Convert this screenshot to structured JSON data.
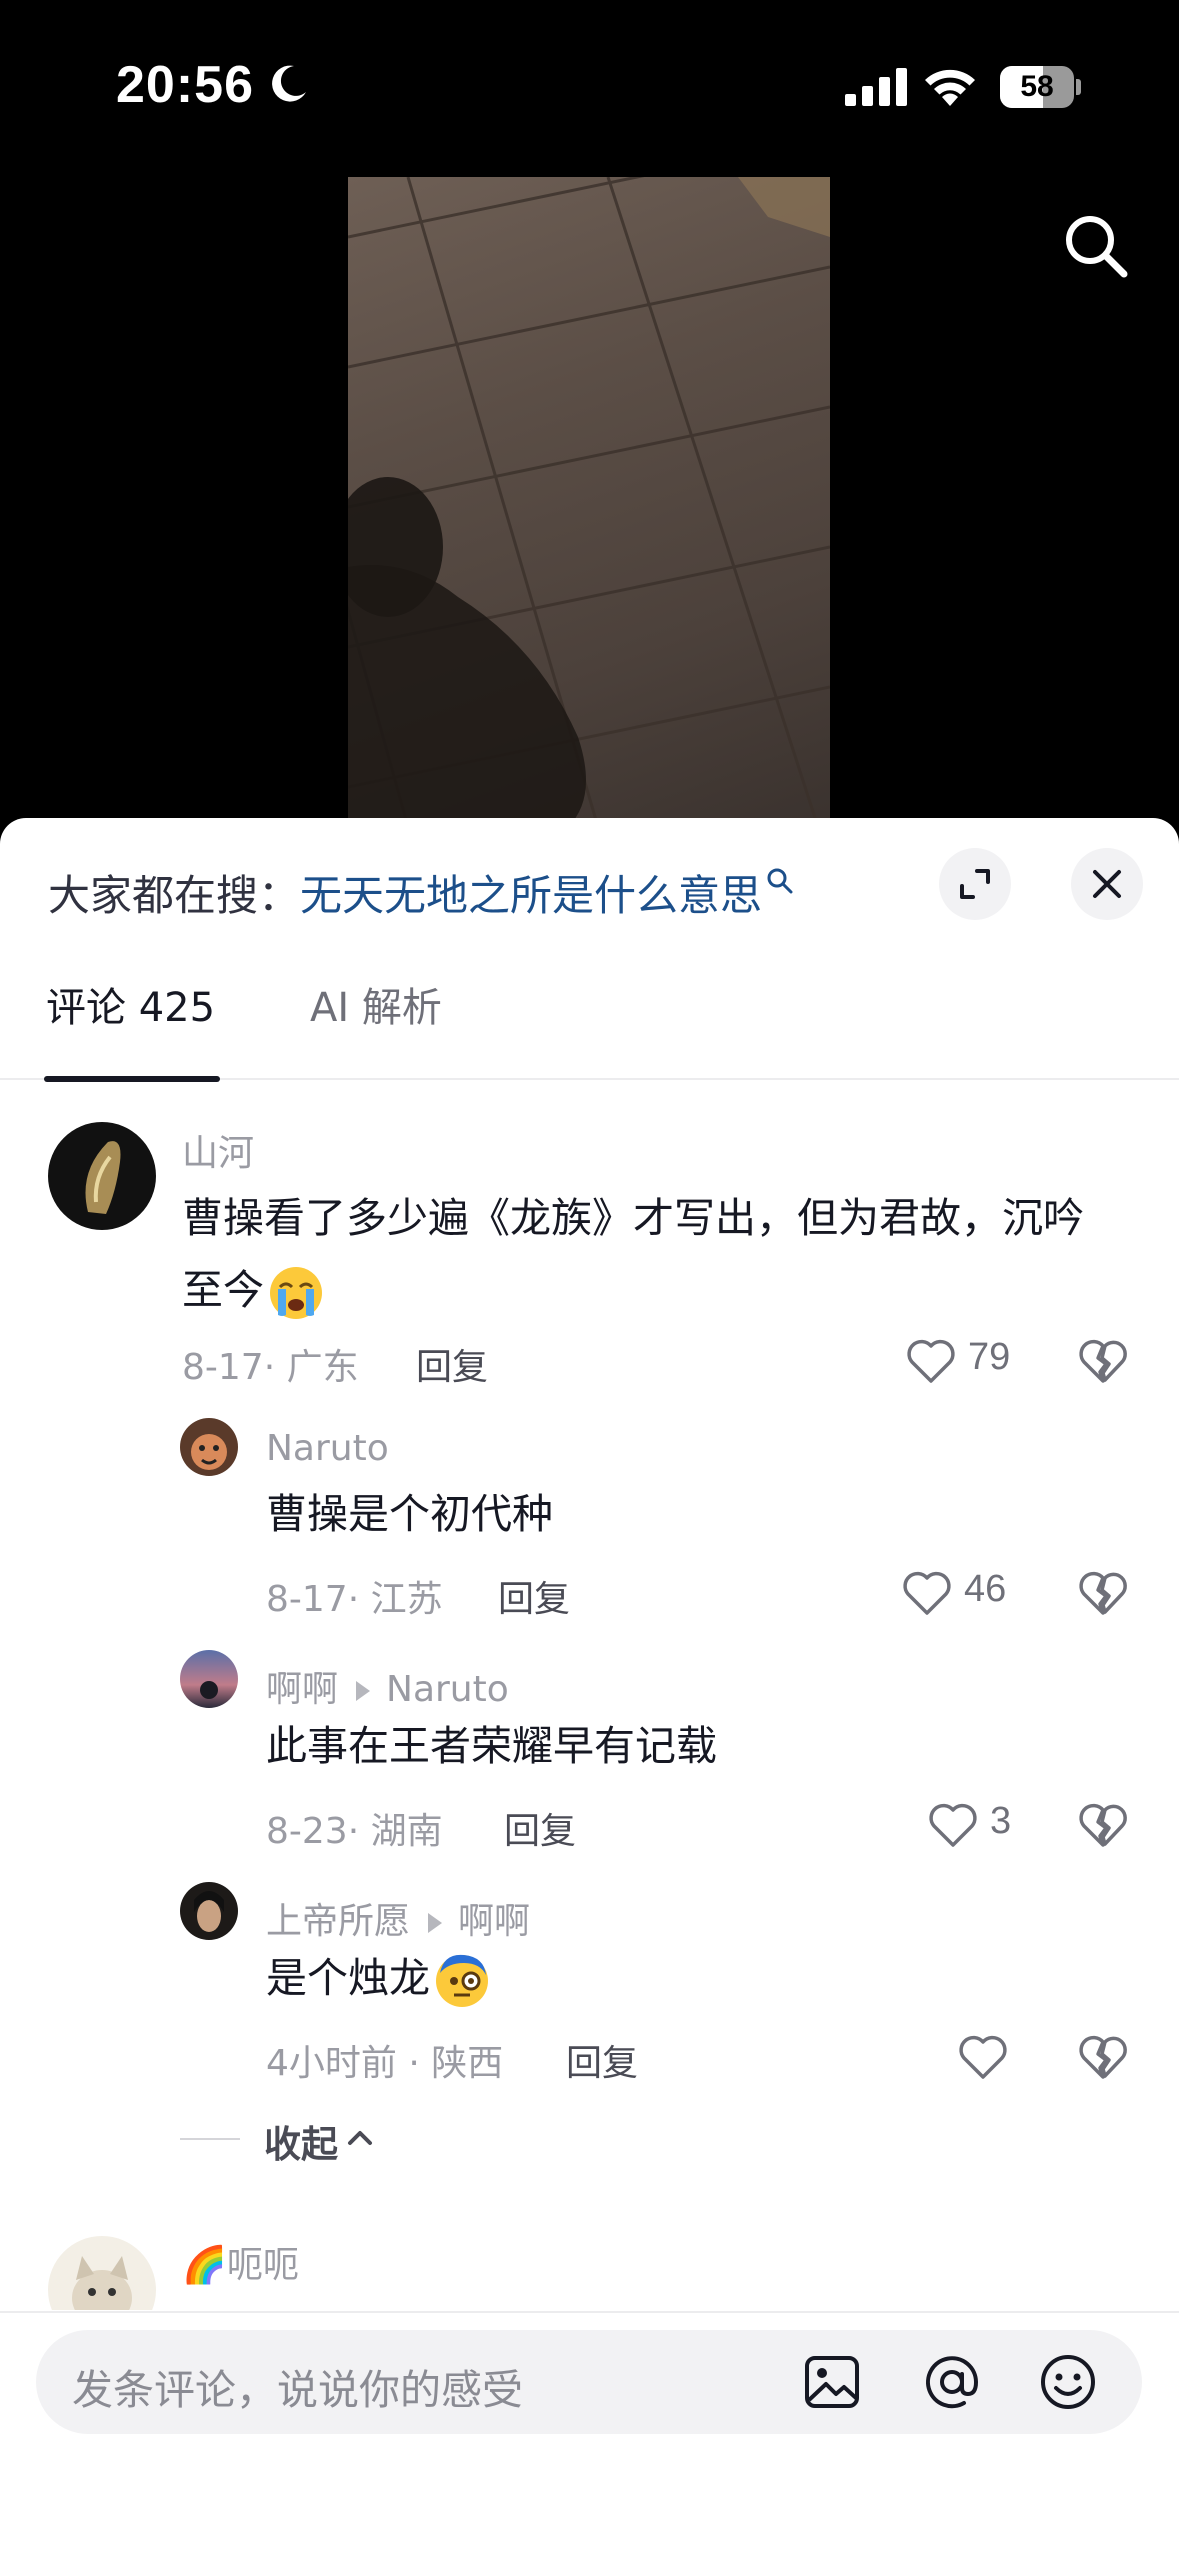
{
  "status_bar": {
    "time": "20:56",
    "battery_percent": "58",
    "battery_level": 0.58
  },
  "video": {
    "description_icons": [
      "search-icon"
    ]
  },
  "hot_search": {
    "prefix": "大家都在搜：",
    "query": "无天无地之所是什么意思"
  },
  "tabs": [
    {
      "label": "评论 425",
      "active": true
    },
    {
      "label": "AI 解析",
      "active": false
    }
  ],
  "comments": [
    {
      "author": "山河",
      "text": "曹操看了多少遍《龙族》才写出，但为君故，沉吟至今",
      "emoji": "loudly-crying-face",
      "date": "8-17",
      "location": "广东",
      "reply_label": "回复",
      "likes": "79"
    },
    {
      "author": "Naruto",
      "text": "曹操是个初代种",
      "date": "8-17",
      "location": "江苏",
      "reply_label": "回复",
      "likes": "46"
    },
    {
      "author": "啊啊",
      "reply_to": "Naruto",
      "text": "此事在王者荣耀早有记载",
      "date": "8-23",
      "location": "湖南",
      "reply_label": "回复",
      "likes": "3"
    },
    {
      "author": "上帝所愿",
      "reply_to": "啊啊",
      "text": "是个烛龙",
      "emoji": "face-with-monocle",
      "date": "4小时前",
      "location": "陕西",
      "reply_label": "回复",
      "likes": ""
    }
  ],
  "collapse_label": "收起",
  "next_comment": {
    "author": "🌈呃呃"
  },
  "input": {
    "placeholder": "发条评论，说说你的感受"
  },
  "colors": {
    "link": "#1c4f8a",
    "text": "#161823",
    "muted": "#9a9ba3"
  }
}
